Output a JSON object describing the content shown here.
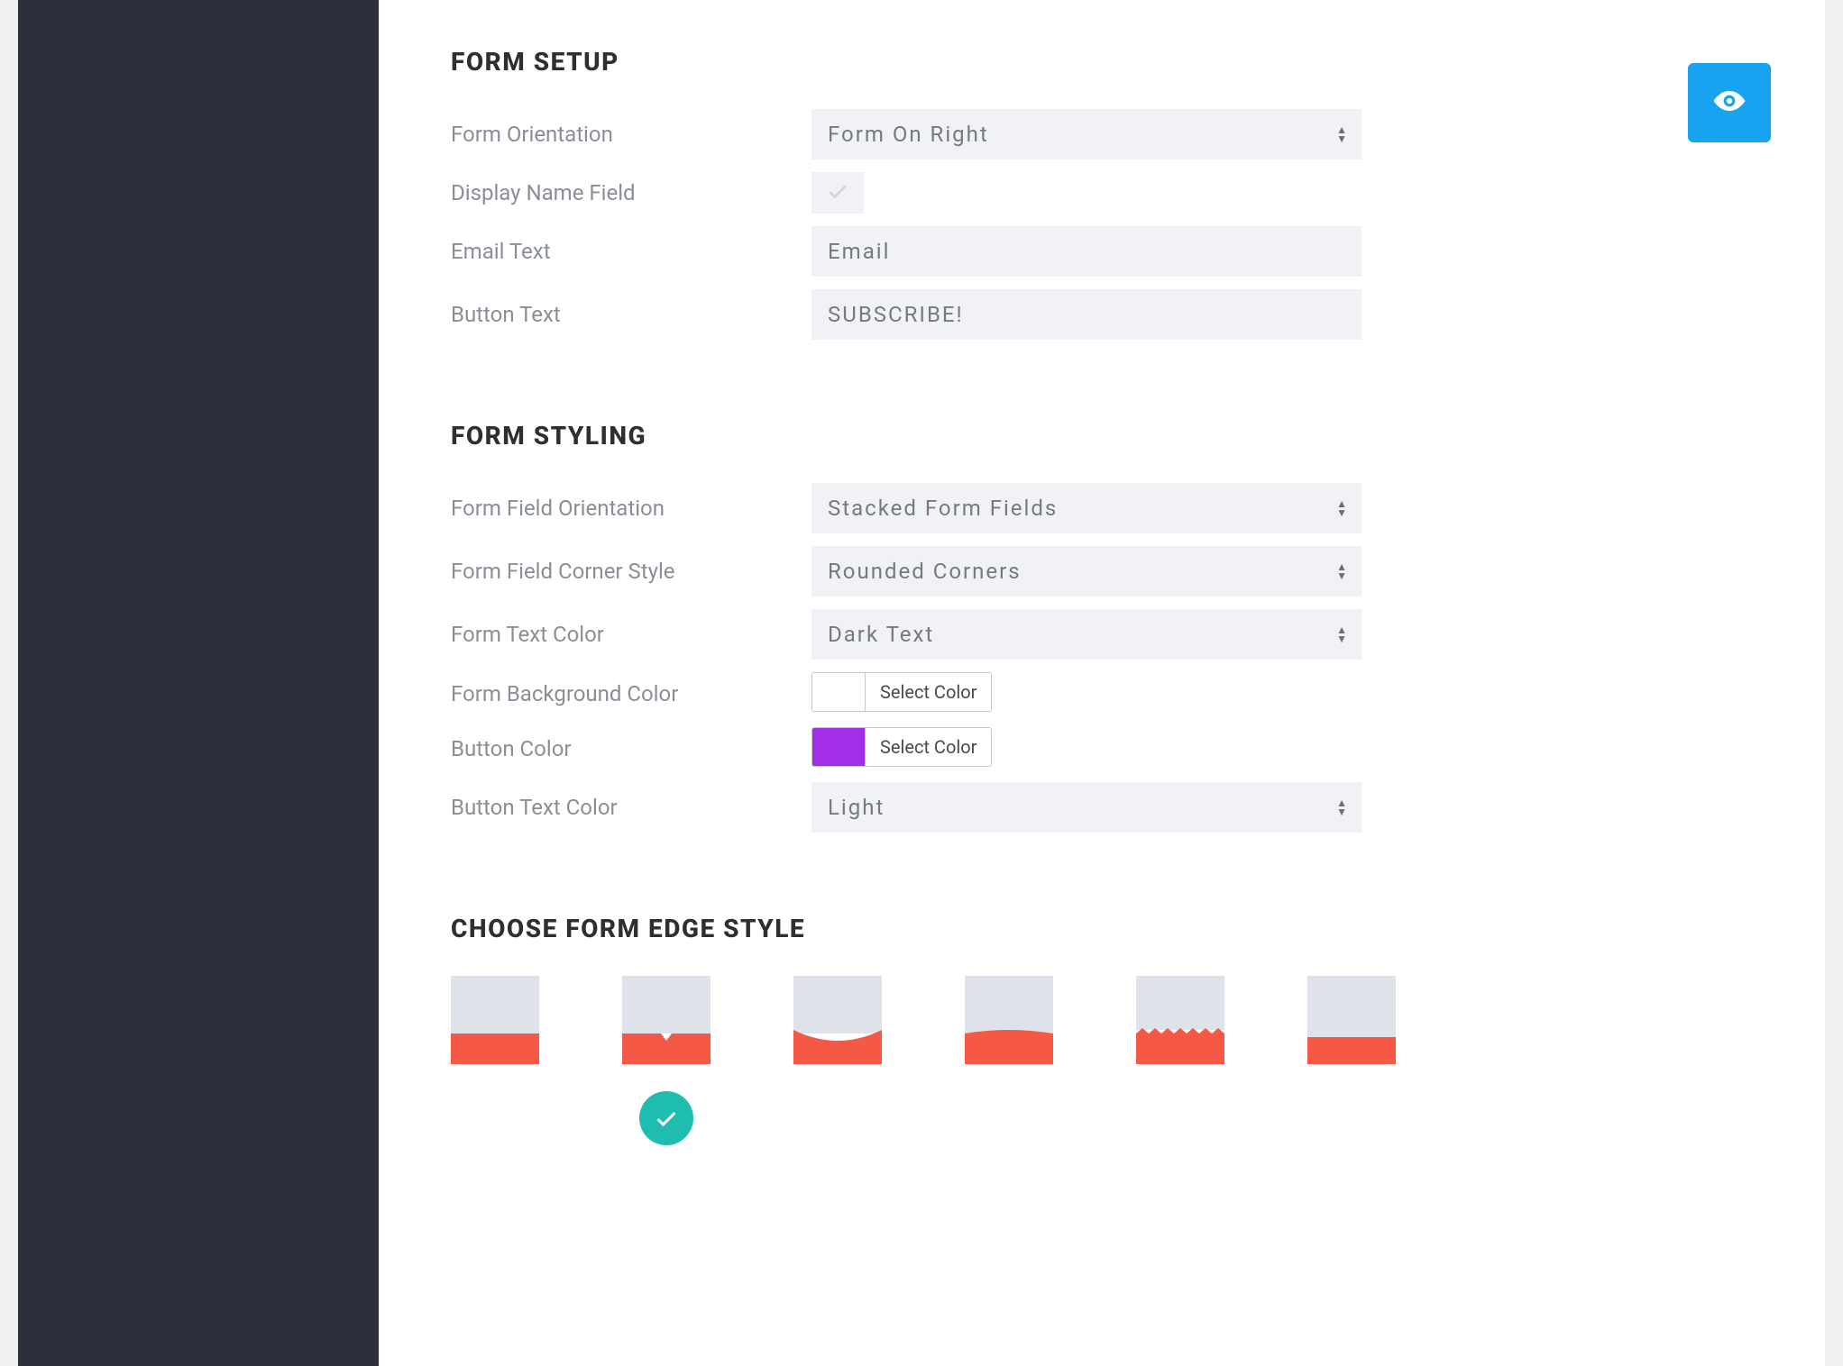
{
  "sections": {
    "form_setup": {
      "title": "FORM SETUP",
      "form_orientation": {
        "label": "Form Orientation",
        "value": "Form On Right"
      },
      "display_name": {
        "label": "Display Name Field",
        "checked": true
      },
      "email_text": {
        "label": "Email Text",
        "value": "Email"
      },
      "button_text": {
        "label": "Button Text",
        "value": "SUBSCRIBE!"
      }
    },
    "form_styling": {
      "title": "FORM STYLING",
      "field_orientation": {
        "label": "Form Field Orientation",
        "value": "Stacked Form Fields"
      },
      "corner_style": {
        "label": "Form Field Corner Style",
        "value": "Rounded Corners"
      },
      "text_color": {
        "label": "Form Text Color",
        "value": "Dark Text"
      },
      "bg_color": {
        "label": "Form Background Color",
        "button": "Select Color",
        "swatch": "#ffffff"
      },
      "button_color": {
        "label": "Button Color",
        "button": "Select Color",
        "swatch": "#a32ee8"
      },
      "button_text_color": {
        "label": "Button Text Color",
        "value": "Light"
      }
    },
    "edge_style": {
      "title": "CHOOSE FORM EDGE STYLE",
      "colors": {
        "top": "#dfe2e8",
        "bottom": "#f55844"
      },
      "selected_index": 1
    }
  }
}
